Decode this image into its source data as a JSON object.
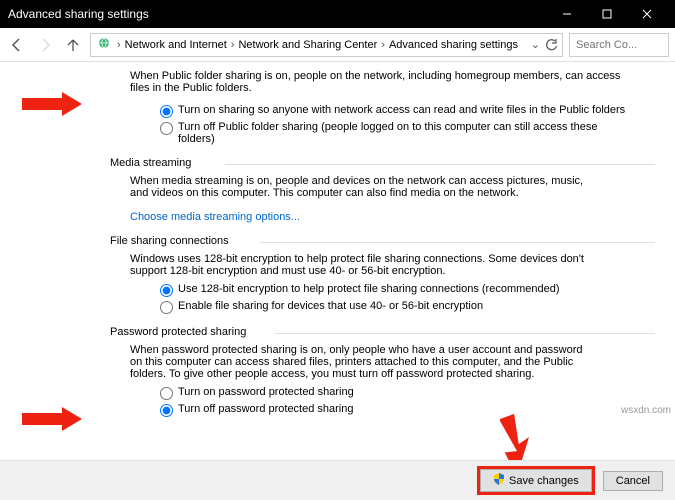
{
  "window": {
    "title": "Advanced sharing settings"
  },
  "breadcrumb": {
    "item1": "Network and Internet",
    "item2": "Network and Sharing Center",
    "item3": "Advanced sharing settings"
  },
  "search": {
    "placeholder": "Search Co..."
  },
  "public_folder": {
    "intro": "When Public folder sharing is on, people on the network, including homegroup members, can access files in the Public folders.",
    "opt_on": "Turn on sharing so anyone with network access can read and write files in the Public folders",
    "opt_off": "Turn off Public folder sharing (people logged on to this computer can still access these folders)"
  },
  "media": {
    "head": "Media streaming",
    "body": "When media streaming is on, people and devices on the network can access pictures, music, and videos on this computer. This computer can also find media on the network.",
    "link": "Choose media streaming options..."
  },
  "file_sharing": {
    "head": "File sharing connections",
    "body": "Windows uses 128-bit encryption to help protect file sharing connections. Some devices don't support 128-bit encryption and must use 40- or 56-bit encryption.",
    "opt128": "Use 128-bit encryption to help protect file sharing connections (recommended)",
    "opt40": "Enable file sharing for devices that use 40- or 56-bit encryption"
  },
  "password": {
    "head": "Password protected sharing",
    "body": "When password protected sharing is on, only people who have a user account and password on this computer can access shared files, printers attached to this computer, and the Public folders. To give other people access, you must turn off password protected sharing.",
    "opt_on": "Turn on password protected sharing",
    "opt_off": "Turn off password protected sharing"
  },
  "buttons": {
    "save": "Save changes",
    "cancel": "Cancel"
  },
  "watermark": "wsxdn.com"
}
